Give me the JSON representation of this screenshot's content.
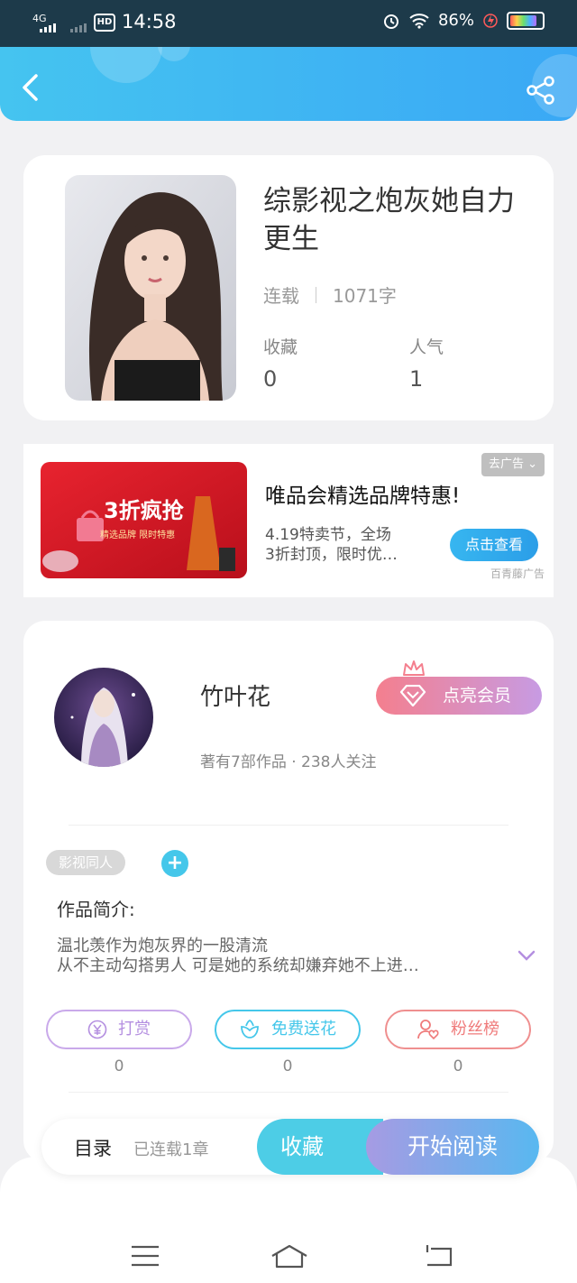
{
  "status_bar": {
    "network": "4G",
    "hd": "HD",
    "time": "14:58",
    "battery": "86%"
  },
  "book": {
    "title": "综影视之炮灰她自力更生",
    "status": "连载",
    "word_count": "1071字",
    "favorites_label": "收藏",
    "favorites_value": "0",
    "popularity_label": "人气",
    "popularity_value": "1"
  },
  "ad": {
    "title": "唯品会精选品牌特惠!",
    "desc_line1": "4.19特卖节，全场",
    "desc_line2": "3折封顶，限时优…",
    "close_label": "去广告",
    "button_label": "点击查看",
    "source": "百青藤广告",
    "image_headline": "3折疯抢",
    "image_sub": "精选品牌  限时特惠"
  },
  "author": {
    "name": "竹叶花",
    "meta": "著有7部作品 · 238人关注",
    "vip_label": "点亮会员"
  },
  "tags": [
    "影视同人"
  ],
  "intro": {
    "title": "作品简介:",
    "line1": "温北羡作为炮灰界的一股清流",
    "line2": "从不主动勾搭男人  可是她的系统却嫌弃她不上进…"
  },
  "actions": [
    {
      "label": "打赏",
      "count": "0",
      "color": "#b48fe0"
    },
    {
      "label": "免费送花",
      "count": "0",
      "color": "#45c7ea"
    },
    {
      "label": "粉丝榜",
      "count": "0",
      "color": "#ef7b7b"
    }
  ],
  "bottom_bar": {
    "catalog": "目录",
    "progress": "已连载1章",
    "favorite": "收藏",
    "read": "开始阅读"
  }
}
